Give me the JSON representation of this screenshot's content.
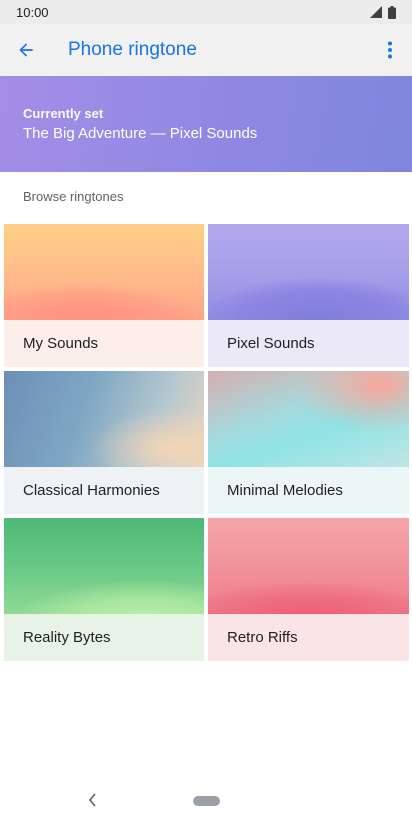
{
  "status_bar": {
    "time": "10:00",
    "icons": [
      "signal-icon",
      "battery-icon"
    ]
  },
  "app_bar": {
    "title": "Phone ringtone",
    "back_icon": "arrow-back-icon",
    "menu_icon": "more-vert-icon",
    "accent": "#1a73e8"
  },
  "current": {
    "label": "Currently set",
    "value": "The Big Adventure — Pixel Sounds"
  },
  "browse": {
    "title": "Browse ringtones",
    "categories": [
      {
        "label": "My Sounds"
      },
      {
        "label": "Pixel Sounds"
      },
      {
        "label": "Classical Harmonies"
      },
      {
        "label": "Minimal Melodies"
      },
      {
        "label": "Reality Bytes"
      },
      {
        "label": "Retro Riffs"
      }
    ]
  },
  "nav_bar": {
    "back_icon": "nav-back-icon",
    "home_icon": "nav-home-pill"
  }
}
